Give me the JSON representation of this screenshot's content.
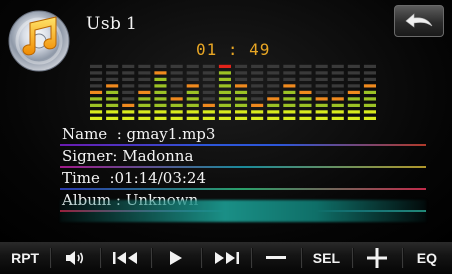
{
  "header": {
    "source": "Usb",
    "track_number": "1",
    "elapsed": "01 : 49",
    "back_icon": "back-arrow-icon",
    "disc_icon": "music-disc-icon"
  },
  "spectrum": {
    "levels": [
      5,
      6,
      3,
      5,
      8,
      4,
      6,
      3,
      9,
      6,
      3,
      4,
      6,
      5,
      4,
      4,
      5,
      6
    ],
    "max_level": 9,
    "colors": {
      "bright": "#d9ec1e",
      "mid": "#9cc225",
      "orange": "#f08a1e",
      "red": "#e2231a",
      "idle": "#3a3a3a"
    }
  },
  "info": [
    {
      "label": "Name",
      "value": "Name  : gmay1.mp3"
    },
    {
      "label": "Signer",
      "value": "Signer: Madonna"
    },
    {
      "label": "Time",
      "value": "Time  :01:14/03:24"
    },
    {
      "label": "Album",
      "value": "Album : Unknown"
    }
  ],
  "controls": [
    {
      "name": "repeat-button",
      "label": "RPT",
      "icon": ""
    },
    {
      "name": "mute-button",
      "label": "",
      "icon": "speaker-icon"
    },
    {
      "name": "previous-button",
      "label": "",
      "icon": "skip-previous-icon"
    },
    {
      "name": "play-button",
      "label": "",
      "icon": "play-icon"
    },
    {
      "name": "next-button",
      "label": "",
      "icon": "skip-next-icon"
    },
    {
      "name": "minus-button",
      "label": "",
      "icon": "minus-icon"
    },
    {
      "name": "select-button",
      "label": "SEL",
      "icon": ""
    },
    {
      "name": "plus-button",
      "label": "",
      "icon": "plus-icon"
    },
    {
      "name": "eq-button",
      "label": "EQ",
      "icon": ""
    }
  ]
}
